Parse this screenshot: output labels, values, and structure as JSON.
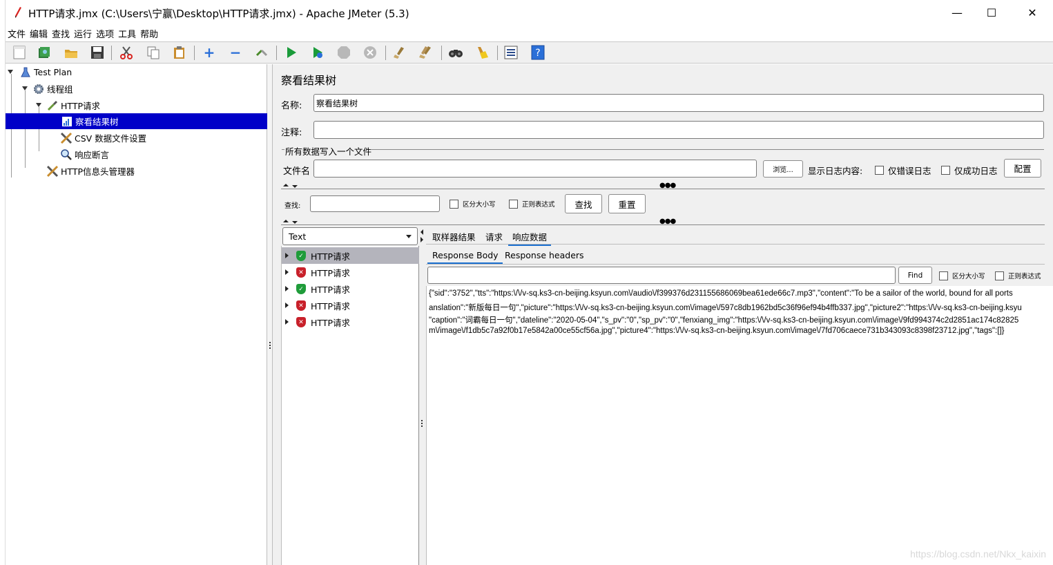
{
  "window": {
    "title": "HTTP请求.jmx (C:\\Users\\宁赢\\Desktop\\HTTP请求.jmx) - Apache JMeter (5.3)",
    "minimize_glyph": "—",
    "maximize_glyph": "☐",
    "close_glyph": "✕"
  },
  "menu": [
    "文件",
    "编辑",
    "查找",
    "运行",
    "选项",
    "工具",
    "帮助"
  ],
  "toolbar": {
    "icons": [
      "new-icon",
      "templates-icon",
      "open-icon",
      "save-icon",
      "cut-icon",
      "copy-icon",
      "paste-icon",
      "expand-icon",
      "collapse-icon",
      "toggle-icon",
      "start-icon",
      "start-no-pause-icon",
      "stop-icon",
      "shutdown-icon",
      "clear-icon",
      "clear-all-icon",
      "search-icon",
      "reset-search-icon",
      "function-helper-icon",
      "help-icon"
    ]
  },
  "tree": {
    "items": [
      {
        "label": "Test Plan",
        "icon": "test-plan-icon"
      },
      {
        "label": "线程组",
        "icon": "gear-icon"
      },
      {
        "label": "HTTP请求",
        "icon": "pipette-icon"
      },
      {
        "label": "察看结果树",
        "icon": "chart-icon",
        "selected": true
      },
      {
        "label": "CSV 数据文件设置",
        "icon": "wrench-icon"
      },
      {
        "label": "响应断言",
        "icon": "magnifier-icon"
      },
      {
        "label": "HTTP信息头管理器",
        "icon": "wrench-icon"
      }
    ]
  },
  "panel": {
    "title": "察看结果树",
    "name_label": "名称:",
    "name_value": "察看结果树",
    "comment_label": "注释:",
    "comment_value": "",
    "file_group_label": "所有数据写入一个文件",
    "filename_label": "文件名",
    "filename_value": "",
    "browse_label": "浏览...",
    "log_content_label": "显示日志内容:",
    "errors_only_label": "仅错误日志",
    "success_only_label": "仅成功日志",
    "configure_label": "配置"
  },
  "search": {
    "label": "查找:",
    "value": "",
    "case_sensitive_label": "区分大小写",
    "regex_label": "正则表达式",
    "find_label": "查找",
    "reset_label": "重置"
  },
  "results": {
    "renderer": "Text",
    "items": [
      {
        "label": "HTTP请求",
        "status": "ok"
      },
      {
        "label": "HTTP请求",
        "status": "error"
      },
      {
        "label": "HTTP请求",
        "status": "ok"
      },
      {
        "label": "HTTP请求",
        "status": "error"
      },
      {
        "label": "HTTP请求",
        "status": "error"
      }
    ]
  },
  "detail_tabs": [
    "取样器结果",
    "请求",
    "响应数据"
  ],
  "active_detail_tab": "响应数据",
  "response_tabs": [
    "Response Body",
    "Response headers"
  ],
  "response_search": {
    "value": "",
    "find_label": "Find",
    "case_sensitive_label": "区分大小写",
    "regex_label": "正则表达式"
  },
  "response_body_lines": [
    "{\"sid\":\"3752\",\"tts\":\"https:\\/\\/v-sq.ks3-cn-beijing.ksyun.com\\/audio\\/f399376d231155686069bea61ede66c7.mp3\",\"content\":\"To be a sailor of the world, bound for all ports",
    "anslation\":\"新版每日一句\",\"picture\":\"https:\\/\\/v-sq.ks3-cn-beijing.ksyun.com\\/image\\/597c8db1962bd5c36f96ef94b4ffb337.jpg\",\"picture2\":\"https:\\/\\/v-sq.ks3-cn-beijing.ksyu",
    "\"caption\":\"词霸每日一句\",\"dateline\":\"2020-05-04\",\"s_pv\":\"0\",\"sp_pv\":\"0\",\"fenxiang_img\":\"https:\\/\\/v-sq.ks3-cn-beijing.ksyun.com\\/image\\/9fd994374c2d2851ac174c82825",
    "m\\/image\\/f1db5c7a92f0b17e5842a00ce55cf56a.jpg\",\"picture4\":\"https:\\/\\/v-sq.ks3-cn-beijing.ksyun.com\\/image\\/7fd706caece731b343093c8398f23712.jpg\",\"tags\":[]}"
  ],
  "watermark": "https://blog.csdn.net/Nkx_kaixin"
}
